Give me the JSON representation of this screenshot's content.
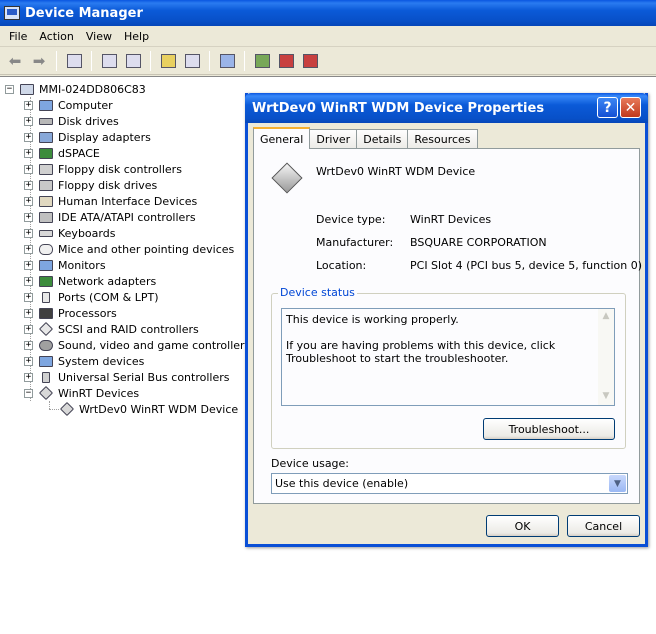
{
  "window": {
    "title": "Device Manager"
  },
  "menu": [
    "File",
    "Action",
    "View",
    "Help"
  ],
  "toolbar": {
    "icons": [
      "back-icon",
      "forward-icon",
      "show-hide-tree-icon",
      "properties-icon",
      "print-icon",
      "help-icon",
      "show-details-icon",
      "scan-hardware-icon",
      "update-driver-icon",
      "uninstall-icon",
      "disable-icon"
    ]
  },
  "tree": {
    "root": "MMI-024DD806C83",
    "items": [
      "Computer",
      "Disk drives",
      "Display adapters",
      "dSPACE",
      "Floppy disk controllers",
      "Floppy disk drives",
      "Human Interface Devices",
      "IDE ATA/ATAPI controllers",
      "Keyboards",
      "Mice and other pointing devices",
      "Monitors",
      "Network adapters",
      "Ports (COM & LPT)",
      "Processors",
      "SCSI and RAID controllers",
      "Sound, video and game controllers",
      "System devices",
      "Universal Serial Bus controllers",
      "WinRT Devices"
    ],
    "child": "WrtDev0 WinRT WDM Device",
    "expander_collapsed": "+",
    "expander_expanded": "−"
  },
  "dialog": {
    "title": "WrtDev0 WinRT WDM Device Properties",
    "help_glyph": "?",
    "close_glyph": "✕",
    "tabs": [
      "General",
      "Driver",
      "Details",
      "Resources"
    ],
    "device_name": "WrtDev0 WinRT WDM Device",
    "fields": [
      {
        "label": "Device type:",
        "value": "WinRT Devices"
      },
      {
        "label": "Manufacturer:",
        "value": "BSQUARE CORPORATION"
      },
      {
        "label": "Location:",
        "value": "PCI Slot 4 (PCI bus 5, device 5, function 0)"
      }
    ],
    "status_group_label": "Device status",
    "status_line1": "This device is working properly.",
    "status_line2": "If you are having problems with this device, click Troubleshoot to start the troubleshooter.",
    "troubleshoot_label": "Troubleshoot...",
    "usage_label": "Device usage:",
    "usage_value": "Use this device (enable)",
    "ok_label": "OK",
    "cancel_label": "Cancel"
  }
}
